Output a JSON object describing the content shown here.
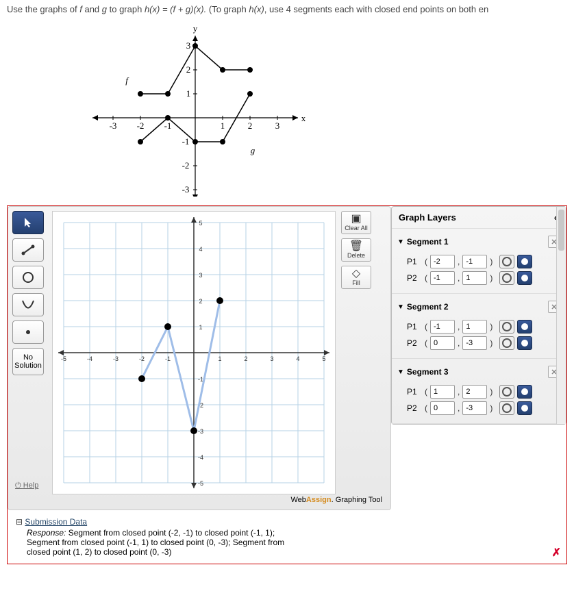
{
  "question": {
    "prefix": "Use the graphs of ",
    "f": "f",
    "and": " and ",
    "g": "g",
    "mid": " to graph  ",
    "hx": "h(x) = (f + g)(x).",
    "suffix": "  (To graph ",
    "hx2": "h(x)",
    "tail": ", use 4 segments each with closed end points on both en"
  },
  "figure": {
    "ylabel": "y",
    "xlabel": "x",
    "f_label": "f",
    "g_label": "g",
    "xticks": [
      "-3",
      "-2",
      "-1",
      "1",
      "2",
      "3"
    ],
    "yticks": [
      "-3",
      "-2",
      "-1",
      "1",
      "2",
      "3"
    ]
  },
  "graph_tool": {
    "canvas": {
      "range": [
        -5,
        5
      ],
      "xticks": [
        "-5",
        "-4",
        "-3",
        "-2",
        "-1",
        "1",
        "2",
        "3",
        "4",
        "5"
      ],
      "yticks": [
        "-5",
        "-4",
        "-3",
        "-2",
        "-1",
        "1",
        "2",
        "3",
        "4",
        "5"
      ]
    },
    "right_buttons": {
      "clear_all": "Clear All",
      "delete": "Delete",
      "fill": "Fill"
    },
    "no_solution": "No\nSolution",
    "help": "Help",
    "brand_prefix": "Web",
    "brand_bold": "Assign",
    "brand_suffix": ". Graphing Tool"
  },
  "layers": {
    "title": "Graph Layers",
    "segments": [
      {
        "name": "Segment 1",
        "p1": [
          "-2",
          "-1"
        ],
        "p2": [
          "-1",
          "1"
        ]
      },
      {
        "name": "Segment 2",
        "p1": [
          "-1",
          "1"
        ],
        "p2": [
          "0",
          "-3"
        ]
      },
      {
        "name": "Segment 3",
        "p1": [
          "1",
          "2"
        ],
        "p2": [
          "0",
          "-3"
        ]
      }
    ],
    "p1_label": "P1",
    "p2_label": "P2"
  },
  "submission": {
    "title": "Submission Data",
    "response_label": "Response:",
    "response_text": " Segment from closed point (-2, -1) to closed point (-1, 1); Segment from closed point (-1, 1) to closed point (0, -3); Segment from closed point (1, 2) to closed point (0, -3)"
  },
  "chart_data": [
    {
      "type": "line",
      "title": "Reference graphs of f and g",
      "xlabel": "x",
      "ylabel": "y",
      "xlim": [
        -3.5,
        3.5
      ],
      "ylim": [
        -3.5,
        3.5
      ],
      "series": [
        {
          "name": "f",
          "x": [
            -2,
            -1,
            0,
            1,
            2
          ],
          "y": [
            1,
            1,
            3,
            2,
            2
          ],
          "endpoints": "closed"
        },
        {
          "name": "g",
          "x": [
            -2,
            -1,
            0,
            1,
            2
          ],
          "y": [
            -1,
            0,
            -1,
            -1,
            1
          ],
          "endpoints": "closed"
        }
      ]
    },
    {
      "type": "line",
      "title": "User-drawn h(x) segments on graphing tool",
      "xlabel": "x",
      "ylabel": "y",
      "xlim": [
        -5,
        5
      ],
      "ylim": [
        -5,
        5
      ],
      "series": [
        {
          "name": "Segment 1",
          "x": [
            -2,
            -1
          ],
          "y": [
            -1,
            1
          ],
          "endpoints": "closed"
        },
        {
          "name": "Segment 2",
          "x": [
            -1,
            0
          ],
          "y": [
            1,
            -3
          ],
          "endpoints": "closed"
        },
        {
          "name": "Segment 3",
          "x": [
            1,
            0
          ],
          "y": [
            2,
            -3
          ],
          "endpoints": "closed"
        }
      ]
    }
  ]
}
